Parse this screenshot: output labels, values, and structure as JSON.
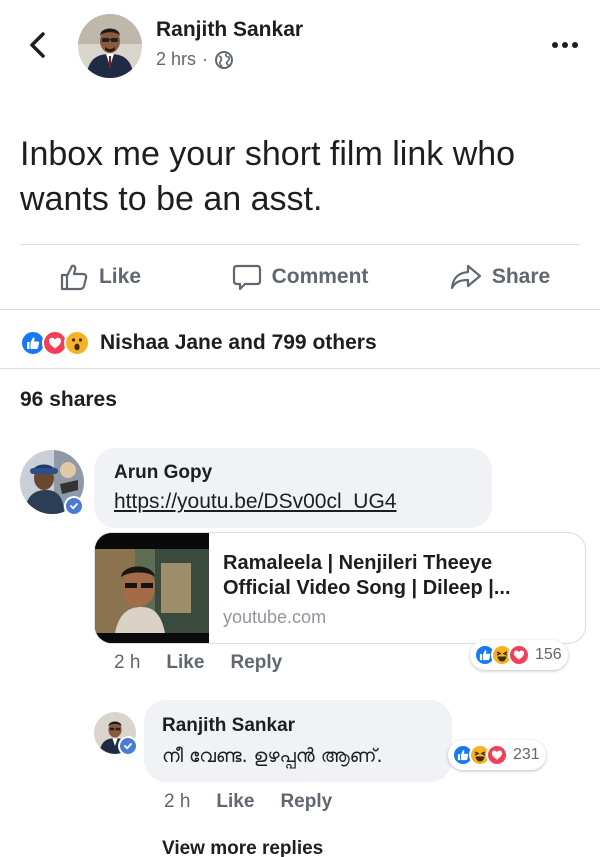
{
  "post": {
    "author": "Ranjith Sankar",
    "time": "2 hrs",
    "separator": "·",
    "text": "Inbox me your short film link who wants to be an asst."
  },
  "actions": {
    "like": "Like",
    "comment": "Comment",
    "share": "Share"
  },
  "reactions": {
    "summary": "Nishaa Jane and 799 others",
    "icons": [
      "like-icon",
      "love-icon",
      "wow-icon"
    ]
  },
  "shares": "96 shares",
  "comments": [
    {
      "author": "Arun Gopy",
      "link": "https://youtu.be/DSv00cl_UG4",
      "preview": {
        "title_line1": "Ramaleela | Nenjileri Theeye",
        "title_line2": "Official Video Song | Dileep |...",
        "domain": "youtube.com"
      },
      "time": "2 h",
      "like": "Like",
      "reply": "Reply",
      "reaction_count": "156",
      "reaction_icons": [
        "like-icon",
        "haha-icon",
        "love-icon"
      ]
    }
  ],
  "reply": {
    "author": "Ranjith Sankar",
    "text": "നീ വേണ്ട. ഉഴപ്പൻ ആണ്.",
    "time": "2 h",
    "like": "Like",
    "reply": "Reply",
    "reaction_count": "231",
    "reaction_icons": [
      "like-icon",
      "haha-icon",
      "love-icon"
    ]
  },
  "view_more": "View more replies",
  "colors": {
    "like_blue": "#1877f2",
    "love_red": "#f33e58",
    "haha_yellow": "#f7b125",
    "text_secondary": "#606770",
    "bubble_bg": "#f0f2f5"
  }
}
